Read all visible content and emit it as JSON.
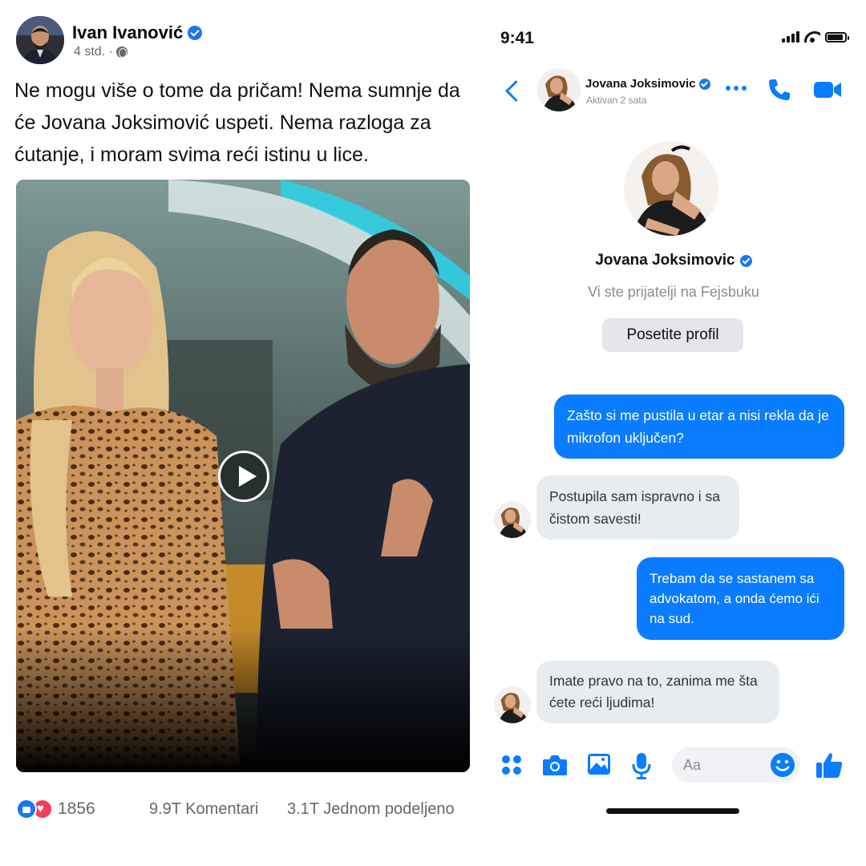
{
  "post": {
    "author": "Ivan Ivanović",
    "time": "4 std. ·",
    "text": "Ne mogu više o tome da pričam! Nema sumnje da će Jovana Joksimović uspeti. Nema razloga za ćutanje, i moram svima reći istinu u lice.",
    "reaction_count": "1856",
    "comments": "9.9T Komentari",
    "shares": "3.1T Jednom podeljeno"
  },
  "status_bar": {
    "time": "9:41"
  },
  "chat_header": {
    "name": "Jovana Joksimovic",
    "status": "Aktivan 2 sata"
  },
  "profile": {
    "name": "Jovana Joksimovic",
    "subtitle": "Vi ste prijatelji na Fejsbuku",
    "button": "Posetite profil"
  },
  "messages": [
    {
      "direction": "out",
      "text": "Zašto si me pustila u etar a nisi rekla da je mikrofon uključen?"
    },
    {
      "direction": "in",
      "text": "Postupila sam ispravno i sa čistom savesti!"
    },
    {
      "direction": "out",
      "text": "Trebam da se sastanem sa advokatom, a onda ćemo ići na sud."
    },
    {
      "direction": "in",
      "text": "Imate pravo na to, zanima me šta ćete reći ljudima!"
    }
  ],
  "composer": {
    "placeholder": "Aa"
  },
  "colors": {
    "messenger_blue": "#0a7cff",
    "facebook_blue": "#1877f2",
    "love_red": "#f33e58",
    "incoming_bubble": "#e8ecef"
  }
}
